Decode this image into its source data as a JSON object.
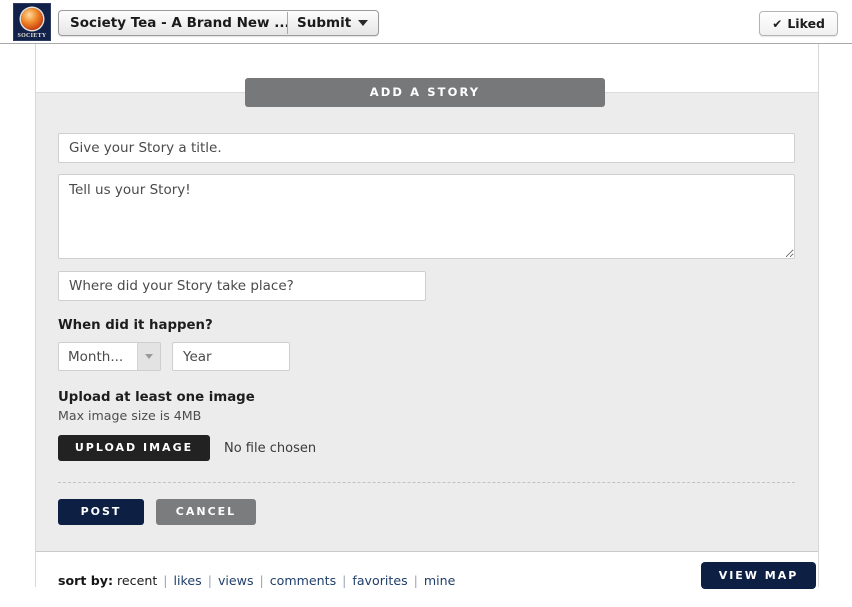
{
  "chrome": {
    "logo_name": "SOCIETY",
    "page_title": "Society Tea - A Brand New ...",
    "submit_label": "Submit",
    "liked_label": "Liked",
    "liked_check": "✔"
  },
  "form": {
    "header_button": "ADD A STORY",
    "title_placeholder": "Give your Story a title.",
    "title_value": "",
    "story_placeholder": "Tell us your Story!",
    "story_value": "",
    "place_placeholder": "Where did your Story take place?",
    "place_value": "",
    "when_label": "When did it happen?",
    "month_selected": "Month...",
    "year_placeholder": "Year",
    "year_value": "",
    "upload_label": "Upload at least one image",
    "upload_sub": "Max image size is 4MB",
    "upload_button": "UPLOAD IMAGE",
    "file_status": "No file chosen",
    "post_button": "POST",
    "cancel_button": "CANCEL"
  },
  "footer": {
    "sort_label": "sort by:",
    "sort_options": [
      "recent",
      "likes",
      "views",
      "comments",
      "favorites",
      "mine"
    ],
    "sort_active": "recent",
    "separator": "|",
    "view_map_button": "VIEW MAP"
  },
  "colors": {
    "navy": "#0d2043",
    "gray_button": "#77787a",
    "dark_button": "#222222",
    "form_bg": "#ececec"
  }
}
